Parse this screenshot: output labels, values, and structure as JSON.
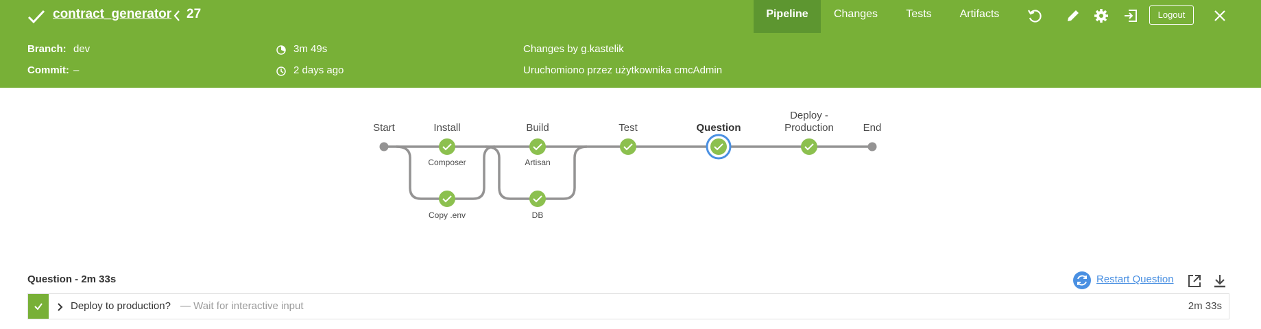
{
  "header": {
    "job_name": "contract_generator",
    "run_number": "27",
    "tabs": [
      "Pipeline",
      "Changes",
      "Tests",
      "Artifacts"
    ],
    "logout_label": "Logout"
  },
  "summary": {
    "branch_label": "Branch:",
    "branch_value": "dev",
    "commit_label": "Commit:",
    "commit_value": "–",
    "duration": "3m 49s",
    "started": "2 days ago",
    "changes_by": "Changes by g.kastelik",
    "cause": "Uruchomiono przez użytkownika cmcAdmin"
  },
  "pipeline": {
    "start_label": "Start",
    "end_label": "End",
    "stages": [
      {
        "name": "Install",
        "steps": [
          "Composer",
          "Copy .env"
        ]
      },
      {
        "name": "Build",
        "steps": [
          "Artisan",
          "DB"
        ]
      },
      {
        "name": "Test",
        "steps": []
      },
      {
        "name": "Question",
        "steps": [],
        "selected": true
      },
      {
        "name": "Deploy -",
        "name2": "Production",
        "steps": []
      }
    ],
    "colors": {
      "success": "#8cc04f",
      "line": "#949393",
      "selected": "#4a90e2"
    }
  },
  "step_panel": {
    "title": "Question - 2m 33s",
    "restart_label": "Restart Question",
    "step": {
      "name": "Deploy to production?",
      "description": "— Wait for interactive input",
      "duration": "2m 33s"
    }
  }
}
